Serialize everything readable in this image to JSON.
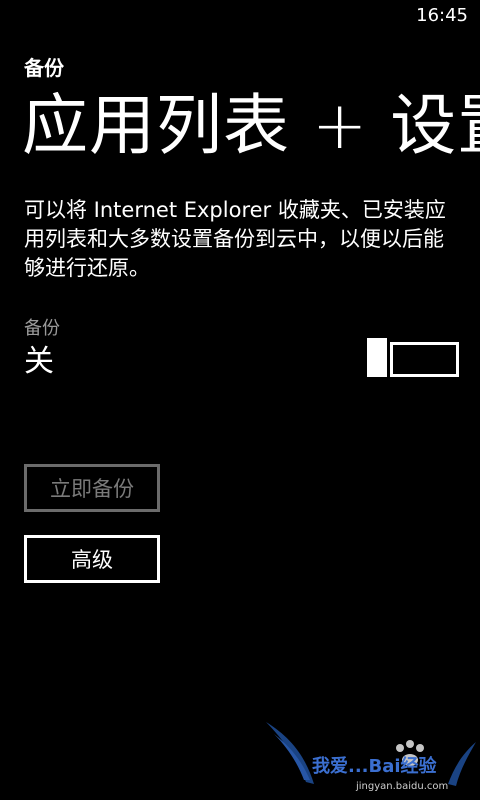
{
  "status": {
    "time": "16:45"
  },
  "header": {
    "app_title": "备份",
    "page_title": "应用列表 + 设置"
  },
  "main": {
    "description": "可以将 Internet Explorer 收藏夹、已安装应用列表和大多数设置备份到云中，以便以后能够进行还原。",
    "backup_toggle": {
      "label": "备份",
      "state_text": "关",
      "is_on": false
    },
    "buttons": {
      "backup_now": "立即备份",
      "advanced": "高级"
    }
  },
  "watermark": {
    "text": "我爱...Bai经验",
    "site": "jingyan.baidu.com"
  }
}
